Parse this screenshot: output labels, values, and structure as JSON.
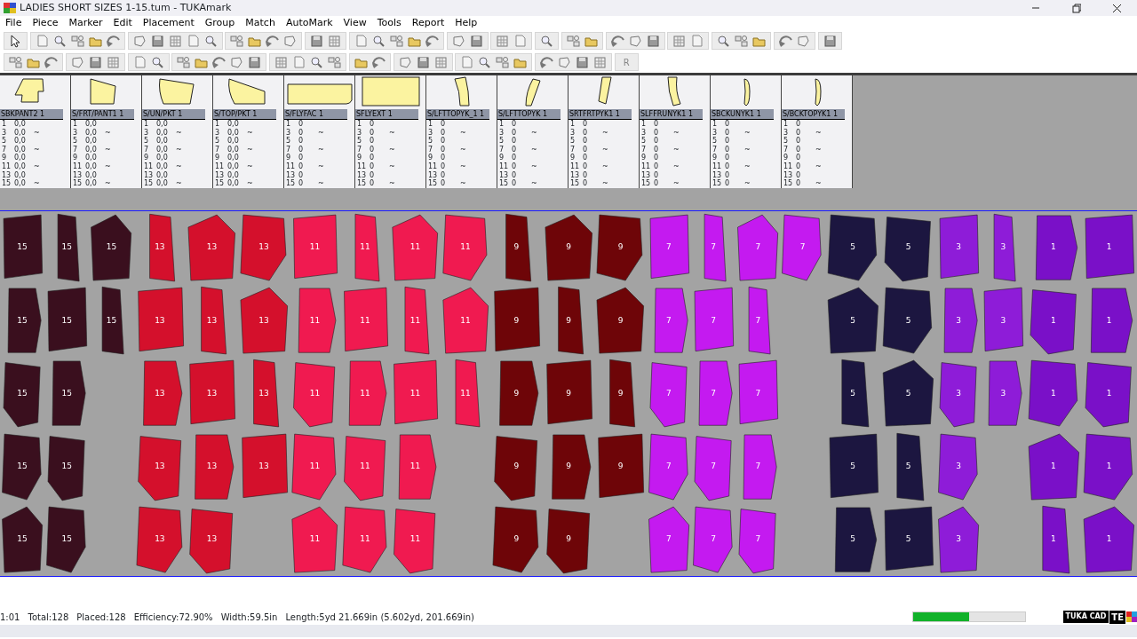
{
  "window": {
    "title": "LADIES SHORT SIZES 1-15.tum - TUKAmark"
  },
  "menu": [
    "File",
    "Piece",
    "Marker",
    "Edit",
    "Placement",
    "Group",
    "Match",
    "AutoMark",
    "View",
    "Tools",
    "Report",
    "Help"
  ],
  "toolbar": {
    "text_buttons": [
      "R"
    ]
  },
  "pieces_panel": [
    {
      "name": "SBKPANT2 1",
      "rows": [
        {
          "size": "1",
          "value": "0,0"
        },
        {
          "size": "3",
          "value": "0,0",
          "mark": "~"
        },
        {
          "size": "5",
          "value": "0,0"
        },
        {
          "size": "7",
          "value": "0,0",
          "mark": "~"
        },
        {
          "size": "9",
          "value": "0,0"
        },
        {
          "size": "11",
          "value": "0,0",
          "mark": "~"
        },
        {
          "size": "13",
          "value": "0,0"
        },
        {
          "size": "15",
          "value": "0,0",
          "mark": "~"
        }
      ]
    },
    {
      "name": "S/FRT/PANT1 1",
      "rows": [
        {
          "size": "1",
          "value": "0,0"
        },
        {
          "size": "3",
          "value": "0,0",
          "mark": "~"
        },
        {
          "size": "5",
          "value": "0,0"
        },
        {
          "size": "7",
          "value": "0,0",
          "mark": "~"
        },
        {
          "size": "9",
          "value": "0,0"
        },
        {
          "size": "11",
          "value": "0,0",
          "mark": "~"
        },
        {
          "size": "13",
          "value": "0,0"
        },
        {
          "size": "15",
          "value": "0,0",
          "mark": "~"
        }
      ]
    },
    {
      "name": "S/UN/PKT 1",
      "rows": [
        {
          "size": "1",
          "value": "0,0"
        },
        {
          "size": "3",
          "value": "0,0",
          "mark": "~"
        },
        {
          "size": "5",
          "value": "0,0"
        },
        {
          "size": "7",
          "value": "0,0",
          "mark": "~"
        },
        {
          "size": "9",
          "value": "0,0"
        },
        {
          "size": "11",
          "value": "0,0",
          "mark": "~"
        },
        {
          "size": "13",
          "value": "0,0"
        },
        {
          "size": "15",
          "value": "0,0",
          "mark": "~"
        }
      ]
    },
    {
      "name": "S/TOP/PKT 1",
      "rows": [
        {
          "size": "1",
          "value": "0,0"
        },
        {
          "size": "3",
          "value": "0,0",
          "mark": "~"
        },
        {
          "size": "5",
          "value": "0,0"
        },
        {
          "size": "7",
          "value": "0,0",
          "mark": "~"
        },
        {
          "size": "9",
          "value": "0,0"
        },
        {
          "size": "11",
          "value": "0,0",
          "mark": "~"
        },
        {
          "size": "13",
          "value": "0,0"
        },
        {
          "size": "15",
          "value": "0,0",
          "mark": "~"
        }
      ]
    },
    {
      "name": "S/FLYFAC 1",
      "rows": [
        {
          "size": "1",
          "value": "0"
        },
        {
          "size": "3",
          "value": "0",
          "mark": "~"
        },
        {
          "size": "5",
          "value": "0"
        },
        {
          "size": "7",
          "value": "0",
          "mark": "~"
        },
        {
          "size": "9",
          "value": "0"
        },
        {
          "size": "11",
          "value": "0",
          "mark": "~"
        },
        {
          "size": "13",
          "value": "0"
        },
        {
          "size": "15",
          "value": "0",
          "mark": "~"
        }
      ]
    },
    {
      "name": "SFLYEXT 1",
      "rows": [
        {
          "size": "1",
          "value": "0"
        },
        {
          "size": "3",
          "value": "0",
          "mark": "~"
        },
        {
          "size": "5",
          "value": "0"
        },
        {
          "size": "7",
          "value": "0",
          "mark": "~"
        },
        {
          "size": "9",
          "value": "0"
        },
        {
          "size": "11",
          "value": "0",
          "mark": "~"
        },
        {
          "size": "13",
          "value": "0"
        },
        {
          "size": "15",
          "value": "0",
          "mark": "~"
        }
      ]
    },
    {
      "name": "S/LFTTOPYK_1 1",
      "rows": [
        {
          "size": "1",
          "value": "0"
        },
        {
          "size": "3",
          "value": "0",
          "mark": "~"
        },
        {
          "size": "5",
          "value": "0"
        },
        {
          "size": "7",
          "value": "0",
          "mark": "~"
        },
        {
          "size": "9",
          "value": "0"
        },
        {
          "size": "11",
          "value": "0",
          "mark": "~"
        },
        {
          "size": "13",
          "value": "0"
        },
        {
          "size": "15",
          "value": "0",
          "mark": "~"
        }
      ]
    },
    {
      "name": "S/LFTTOPYK 1",
      "rows": [
        {
          "size": "1",
          "value": "0"
        },
        {
          "size": "3",
          "value": "0",
          "mark": "~"
        },
        {
          "size": "5",
          "value": "0"
        },
        {
          "size": "7",
          "value": "0",
          "mark": "~"
        },
        {
          "size": "9",
          "value": "0"
        },
        {
          "size": "11",
          "value": "0",
          "mark": "~"
        },
        {
          "size": "13",
          "value": "0"
        },
        {
          "size": "15",
          "value": "0",
          "mark": "~"
        }
      ]
    },
    {
      "name": "SRTFRTPYK1 1",
      "rows": [
        {
          "size": "1",
          "value": "0"
        },
        {
          "size": "3",
          "value": "0",
          "mark": "~"
        },
        {
          "size": "5",
          "value": "0"
        },
        {
          "size": "7",
          "value": "0",
          "mark": "~"
        },
        {
          "size": "9",
          "value": "0"
        },
        {
          "size": "11",
          "value": "0",
          "mark": "~"
        },
        {
          "size": "13",
          "value": "0"
        },
        {
          "size": "15",
          "value": "0",
          "mark": "~"
        }
      ]
    },
    {
      "name": "SLFFRUNYK1 1",
      "rows": [
        {
          "size": "1",
          "value": "0"
        },
        {
          "size": "3",
          "value": "0",
          "mark": "~"
        },
        {
          "size": "5",
          "value": "0"
        },
        {
          "size": "7",
          "value": "0",
          "mark": "~"
        },
        {
          "size": "9",
          "value": "0"
        },
        {
          "size": "11",
          "value": "0",
          "mark": "~"
        },
        {
          "size": "13",
          "value": "0"
        },
        {
          "size": "15",
          "value": "0",
          "mark": "~"
        }
      ]
    },
    {
      "name": "SBCKUNYK1 1",
      "rows": [
        {
          "size": "1",
          "value": "0"
        },
        {
          "size": "3",
          "value": "0",
          "mark": "~"
        },
        {
          "size": "5",
          "value": "0"
        },
        {
          "size": "7",
          "value": "0",
          "mark": "~"
        },
        {
          "size": "9",
          "value": "0"
        },
        {
          "size": "11",
          "value": "0",
          "mark": "~"
        },
        {
          "size": "13",
          "value": "0"
        },
        {
          "size": "15",
          "value": "0",
          "mark": "~"
        }
      ]
    },
    {
      "name": "S/BCKTOPYK1 1",
      "rows": [
        {
          "size": "1",
          "value": "0"
        },
        {
          "size": "3",
          "value": "0",
          "mark": "~"
        },
        {
          "size": "5",
          "value": "0"
        },
        {
          "size": "7",
          "value": "0",
          "mark": "~"
        },
        {
          "size": "9",
          "value": "0"
        },
        {
          "size": "11",
          "value": "0",
          "mark": "~"
        },
        {
          "size": "13",
          "value": "0"
        },
        {
          "size": "15",
          "value": "0",
          "mark": "~"
        }
      ]
    }
  ],
  "marker": {
    "bands": [
      {
        "color": "#3a0f1e",
        "pieces": [
          "15",
          "15",
          "15",
          "15",
          "15",
          "15",
          "15",
          "15",
          "15",
          "15",
          "15",
          "15"
        ]
      },
      {
        "color": "#d4102c",
        "pieces": [
          "13",
          "13",
          "13",
          "13",
          "13",
          "13",
          "13",
          "13",
          "13",
          "13",
          "13",
          "13",
          "13",
          "13"
        ]
      },
      {
        "color": "#f01a50",
        "pieces": [
          "11",
          "11",
          "11",
          "11",
          "11",
          "11",
          "11",
          "11",
          "11",
          "11",
          "11",
          "11",
          "11",
          "11",
          "11",
          "11",
          "11",
          "11"
        ]
      },
      {
        "color": "#6e0508",
        "pieces": [
          "9",
          "9",
          "9",
          "9",
          "9",
          "9",
          "9",
          "9",
          "9",
          "9",
          "9",
          "9",
          "9",
          "9"
        ]
      },
      {
        "color": "#c41af0",
        "pieces": [
          "7",
          "7",
          "7",
          "7",
          "7",
          "7",
          "7",
          "7",
          "7",
          "7",
          "7",
          "7",
          "7",
          "7",
          "7",
          "7"
        ]
      },
      {
        "color": "#1c1640",
        "pieces": [
          "5",
          "5",
          "5",
          "5",
          "5",
          "5",
          "5",
          "5",
          "5",
          "5"
        ]
      },
      {
        "color": "#8e1cd8",
        "pieces": [
          "3",
          "3",
          "3",
          "3",
          "3",
          "3",
          "3",
          "3"
        ]
      },
      {
        "color": "#7a10c8",
        "pieces": [
          "1",
          "1",
          "1",
          "1",
          "1",
          "1",
          "1",
          "1",
          "1",
          "1"
        ]
      }
    ]
  },
  "status_bar": {
    "fields": [
      "1:01",
      "Total:128",
      "Placed:128",
      "Efficiency:72.90%",
      "Width:59.5in",
      "Length:5yd 21.669in (5.602yd, 201.669in)"
    ],
    "level": 0.5,
    "brand": [
      "TUKA CAD",
      "TE"
    ]
  }
}
